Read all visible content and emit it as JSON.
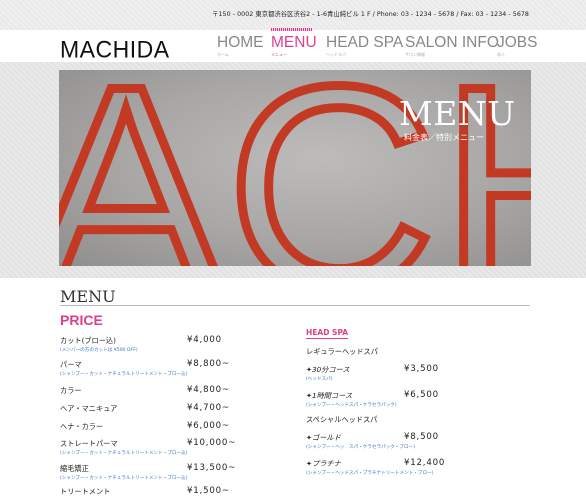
{
  "header": {
    "address": "〒150 - 0002 東京都渋谷区渋谷2 - 1-6青山純ビル 1 F /  Phone: 03 - 1234 - 5678 / Fax: 03 - 1234 - 5678",
    "logo": "MACHIDA"
  },
  "nav": [
    {
      "label": "HOME",
      "sub": "ホーム"
    },
    {
      "label": "MENU",
      "sub": "メニュー"
    },
    {
      "label": "HEAD SPA",
      "sub": "ヘッドスパ"
    },
    {
      "label": "SALON INFO",
      "sub": "サロン情報"
    },
    {
      "label": "JOBS",
      "sub": "求人"
    }
  ],
  "nav_active_color": "#de3e8d",
  "hero": {
    "background_letters": "ACHIDA",
    "title": "MENU",
    "subtitle": "料金表／特別メニュー",
    "letter_color": "#c33a24"
  },
  "section": {
    "title": "MENU",
    "price_heading": "PRICE"
  },
  "price_items": [
    {
      "name": "カット(ブロー込)",
      "note": "(メンバーの方のカットは ¥500 OFF)",
      "price": "¥4,000"
    },
    {
      "name": "パーマ",
      "note": "(シャンプー・カット・ナチュラルトリートメント・ブロー込)",
      "price": "¥8,800~"
    },
    {
      "name": "カラー",
      "note": "",
      "price": "¥4,800~"
    },
    {
      "name": "ヘア・マニキュア",
      "note": "",
      "price": "¥4,700~"
    },
    {
      "name": "ヘナ・カラー",
      "note": "",
      "price": "¥6,000~"
    },
    {
      "name": "ストレートパーマ",
      "note": "(シャンプー・カット・ナチュラルトリートメント・ブロー込)",
      "price": "¥10,000~"
    },
    {
      "name": "縮毛矯正",
      "note": "(シャンプー・カット・ナチュラルトリートメント・ブロー込)",
      "price": "¥13,500~"
    },
    {
      "name": "トリートメント",
      "note": "",
      "price": "¥1,500~"
    }
  ],
  "head_spa": {
    "heading": "HEAD SPA",
    "regular_label": "レギュラーヘッドスパ",
    "special_label": "スペシャルヘッドスパ",
    "regular_items": [
      {
        "name": "✦30分コース",
        "note": "(ヘッドスパ)",
        "price": "¥3,500"
      },
      {
        "name": "✦1時間コース",
        "note": "(シャンプー・ヘッドスパ・ケラセラパック)",
        "price": "¥6,500"
      }
    ],
    "special_items": [
      {
        "name": "✦ゴールド",
        "note": "(シャンプー・ヘッ　スパ・ケラセラパック・ブロー)",
        "price": "¥8,500"
      },
      {
        "name": "✦プラチナ",
        "note": "(シャンプー・ヘッドスパ・プラチナトリートメント・ブロー)",
        "price": "¥12,400"
      }
    ]
  }
}
